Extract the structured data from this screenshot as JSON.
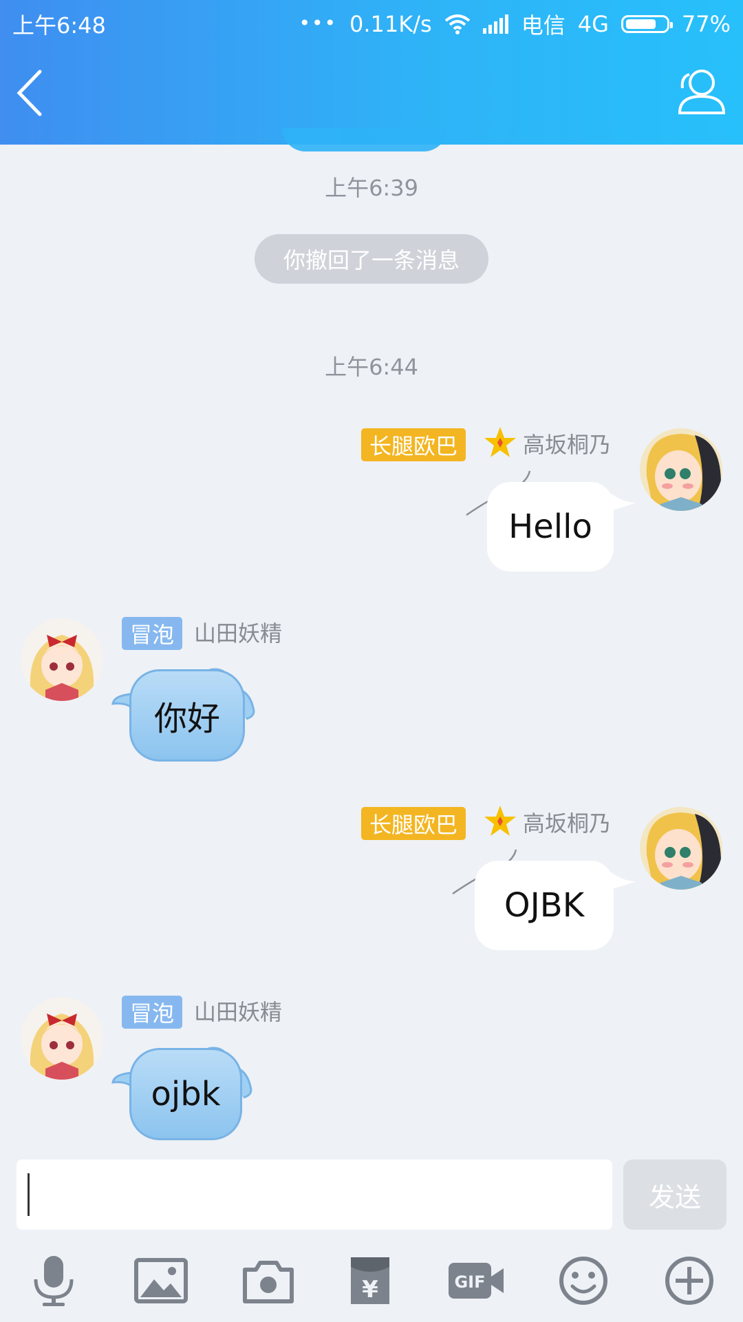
{
  "status_bar": {
    "time": "上午6:48",
    "dots": "•••",
    "speed": "0.11K/s",
    "carrier": "电信",
    "network": "4G",
    "battery": "77%",
    "battery_level": 0.77
  },
  "chat": {
    "timestamps": [
      "上午6:39",
      "上午6:44"
    ],
    "recall_notice": "你撤回了一条消息",
    "messages": [
      {
        "side": "right",
        "tag": "长腿欧巴",
        "name": "高坂桐乃",
        "text": "Hello"
      },
      {
        "side": "left",
        "tag": "冒泡",
        "name": "山田妖精",
        "text": "你好"
      },
      {
        "side": "right",
        "tag": "长腿欧巴",
        "name": "高坂桐乃",
        "text": "OJBK"
      },
      {
        "side": "left",
        "tag": "冒泡",
        "name": "山田妖精",
        "text": "ojbk"
      }
    ]
  },
  "input": {
    "value": "",
    "send_label": "发送"
  },
  "toolbar": {
    "icons": [
      "microphone-icon",
      "image-icon",
      "camera-icon",
      "red-packet-icon",
      "gif-icon",
      "emoji-icon",
      "plus-icon"
    ]
  },
  "colors": {
    "header_start": "#3f8ef0",
    "header_end": "#27c0fb",
    "tag_gold": "#f3b521",
    "tag_blue": "#86b8ef",
    "bubble_blue": "#9fd0f3",
    "background": "#eef1f6"
  }
}
